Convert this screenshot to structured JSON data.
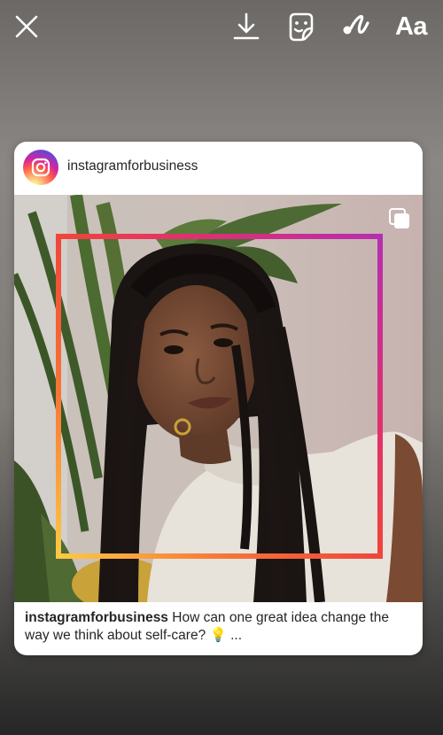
{
  "toolbar": {
    "close_icon": "close-icon",
    "download_icon": "download-icon",
    "sticker_icon": "sticker-icon",
    "draw_icon": "draw-icon",
    "text_label": "Aa"
  },
  "post": {
    "username": "instagramforbusiness",
    "caption_user": "instagramforbusiness",
    "caption_text": "How can one great idea change the way we think about self-care? 💡 ...",
    "multi_icon": "carousel-icon"
  },
  "colors": {
    "accent_gradient": [
      "#b52fae",
      "#e1306c",
      "#f0453a",
      "#f77737",
      "#fcc945"
    ]
  }
}
